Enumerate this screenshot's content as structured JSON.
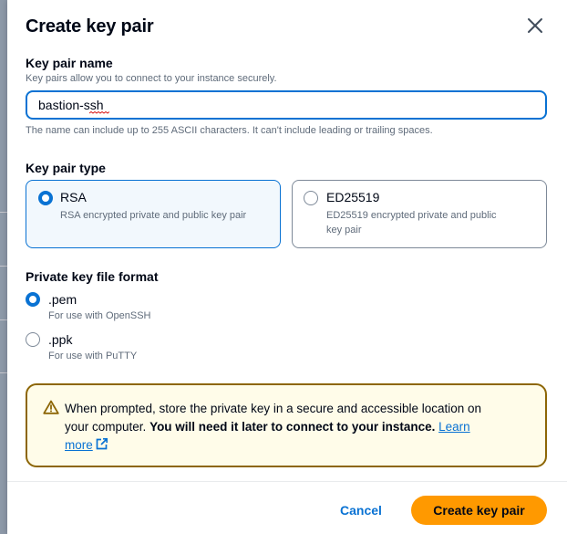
{
  "modal": {
    "title": "Create key pair",
    "close_icon": "close-icon"
  },
  "key_pair_name": {
    "label": "Key pair name",
    "description": "Key pairs allow you to connect to your instance securely.",
    "value": "bastion-ssh",
    "constraint": "The name can include up to 255 ASCII characters. It can't include leading or trailing spaces."
  },
  "key_pair_type": {
    "label": "Key pair type",
    "options": [
      {
        "label": "RSA",
        "description": "RSA encrypted private and public key pair",
        "selected": true
      },
      {
        "label": "ED25519",
        "description_line1": "ED25519 encrypted private and public",
        "description_line2": "key pair",
        "selected": false
      }
    ]
  },
  "file_format": {
    "label": "Private key file format",
    "options": [
      {
        "label": ".pem",
        "description": "For use with OpenSSH",
        "selected": true
      },
      {
        "label": ".ppk",
        "description": "For use with PuTTY",
        "selected": false
      }
    ]
  },
  "alert": {
    "icon": "warning-icon",
    "text_line1": "When prompted, store the private key in a secure and accessible location on",
    "text_line2_plain": "your computer.",
    "text_line2_bold": "You will need it later to connect to your instance.",
    "link_part1": "Learn",
    "link_part2": "more",
    "link_icon": "external-link-icon"
  },
  "footer": {
    "cancel_label": "Cancel",
    "create_label": "Create key pair"
  },
  "colors": {
    "accent": "#0972d3",
    "primary_button": "#ff9900",
    "warning_border": "#8d6605",
    "warning_bg": "#fffce9"
  }
}
